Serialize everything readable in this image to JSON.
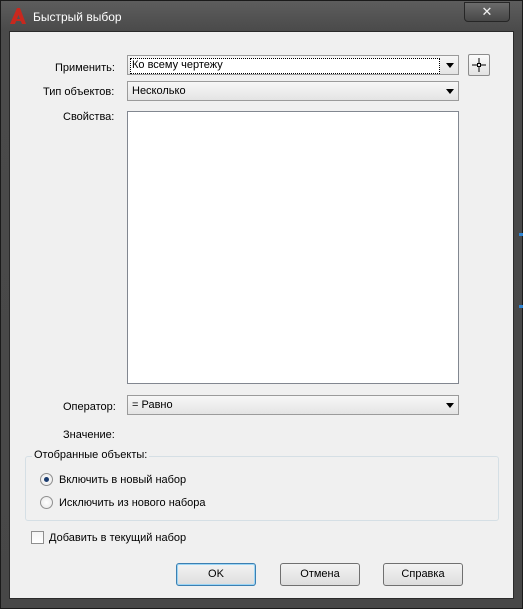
{
  "window": {
    "title": "Быстрый выбор",
    "close_glyph": "✕"
  },
  "icons": {
    "app": "autocad-logo-icon",
    "close": "close-icon",
    "pick": "select-objects-crosshair-icon",
    "dropdown": "chevron-down-icon"
  },
  "colors": {
    "accent": "#2e86d6",
    "logo": "#c8281e",
    "dialog_bg": "#f0f0f0",
    "frame": "#4a4a4a"
  },
  "form": {
    "apply_to": {
      "label": "Применить:",
      "value": "Ко всему чертежу"
    },
    "object_type": {
      "label": "Тип объектов:",
      "value": "Несколько"
    },
    "properties": {
      "label": "Свойства:",
      "items": []
    },
    "operator": {
      "label": "Оператор:",
      "value": "= Равно"
    },
    "value": {
      "label": "Значение:"
    }
  },
  "selection_group": {
    "title": "Отобранные объекты:",
    "include": {
      "label": "Включить в новый набор",
      "checked": true
    },
    "exclude": {
      "label": "Исключить из нового набора",
      "checked": false
    }
  },
  "append": {
    "label": "Добавить в текущий набор",
    "checked": false
  },
  "buttons": {
    "ok": "OK",
    "cancel": "Отмена",
    "help": "Справка"
  }
}
